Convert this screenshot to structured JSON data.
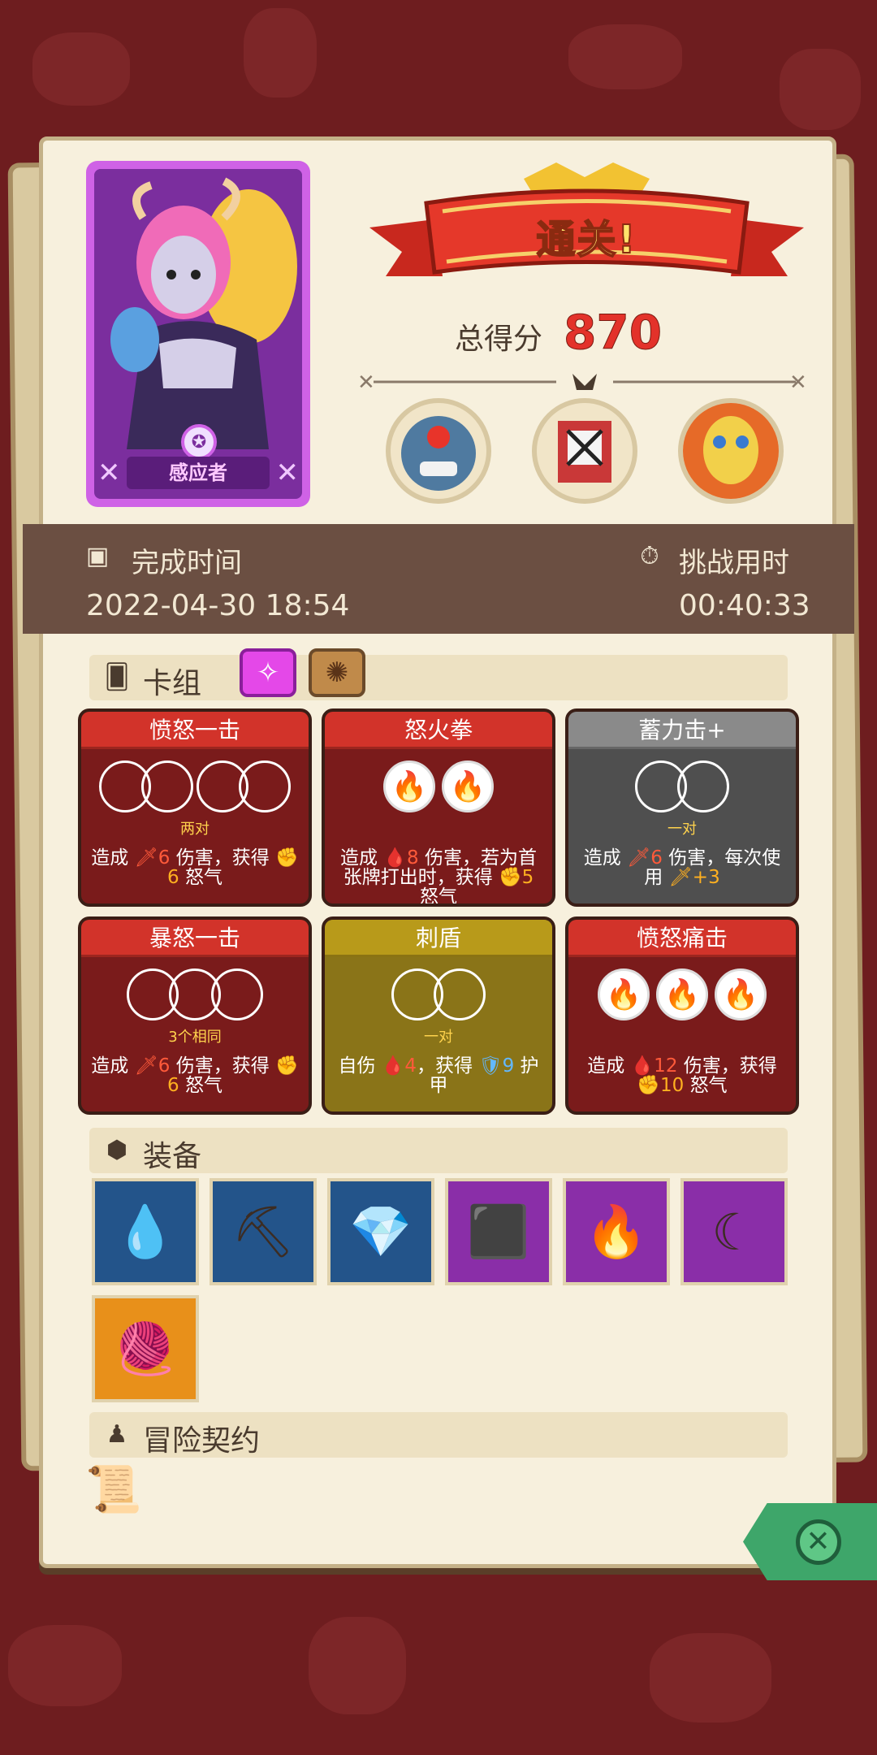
{
  "character": {
    "name": "感应者",
    "emblem_icon": "star-emblem-icon"
  },
  "result": {
    "banner": "通关!",
    "score_label": "总得分",
    "score": "870"
  },
  "bosses": [
    {
      "name": "boss-blue-ogre",
      "color": "#4f7aa0"
    },
    {
      "name": "boss-cage-demon",
      "color": "#c93838"
    },
    {
      "name": "boss-masked-lord",
      "color": "#e66a28"
    }
  ],
  "times": {
    "complete_label": "完成时间",
    "complete_value": "2022-04-30 18:54",
    "duration_label": "挑战用时",
    "duration_value": "00:40:33"
  },
  "deck": {
    "title": "卡组",
    "cards": [
      {
        "title": "愤怒一击",
        "theme": "red",
        "slots": "two-pair",
        "sub": "两对",
        "desc_pre": "造成 ",
        "dmg": "🗡6",
        "mid": " 伤害，获得 ",
        "gain": "✊6",
        "post": " 怒气"
      },
      {
        "title": "怒火拳",
        "theme": "red",
        "slots": "fire-2",
        "sub": "",
        "desc_pre": "造成 ",
        "dmg": "🩸8",
        "mid": " 伤害，若为首张牌打出时，获得 ",
        "gain": "✊5",
        "post": " 怒气"
      },
      {
        "title": "蓄力击+",
        "theme": "gray",
        "slots": "pair",
        "sub": "一对",
        "desc_pre": "造成 ",
        "dmg": "🗡6",
        "mid": " 伤害，每次使用 ",
        "gain": "🗡+3",
        "post": ""
      },
      {
        "title": "暴怒一击",
        "theme": "red",
        "slots": "three",
        "sub": "3个相同",
        "desc_pre": "造成 ",
        "dmg": "🗡6",
        "mid": " 伤害，获得 ",
        "gain": "✊6",
        "post": " 怒气"
      },
      {
        "title": "刺盾",
        "theme": "gold",
        "slots": "pair",
        "sub": "一对",
        "desc_pre": "自伤 ",
        "dmg": "🩸4",
        "mid": "，获得 ",
        "gain": "🛡9",
        "post": " 护甲"
      },
      {
        "title": "愤怒痛击",
        "theme": "red",
        "slots": "fire-3",
        "sub": "",
        "desc_pre": "造成 ",
        "dmg": "🩸12",
        "mid": " 伤害，获得 ",
        "gain": "✊10",
        "post": " 怒气"
      }
    ]
  },
  "equipment": {
    "title": "装备",
    "items": [
      {
        "name": "blue-gem-icon",
        "glyph": "💧",
        "bg": "#23548a"
      },
      {
        "name": "pickaxe-icon",
        "glyph": "⛏",
        "bg": "#23548a"
      },
      {
        "name": "emerald-icon",
        "glyph": "💎",
        "bg": "#23548a"
      },
      {
        "name": "stone-cube-icon",
        "glyph": "⬛",
        "bg": "#8a2ea8"
      },
      {
        "name": "fire-potion-icon",
        "glyph": "🔥",
        "bg": "#8a2ea8"
      },
      {
        "name": "crescent-blade-icon",
        "glyph": "☾",
        "bg": "#8a2ea8"
      },
      {
        "name": "orange-sweater-icon",
        "glyph": "🧶",
        "bg": "#e8901a"
      }
    ]
  },
  "contract": {
    "title": "冒险契约"
  }
}
